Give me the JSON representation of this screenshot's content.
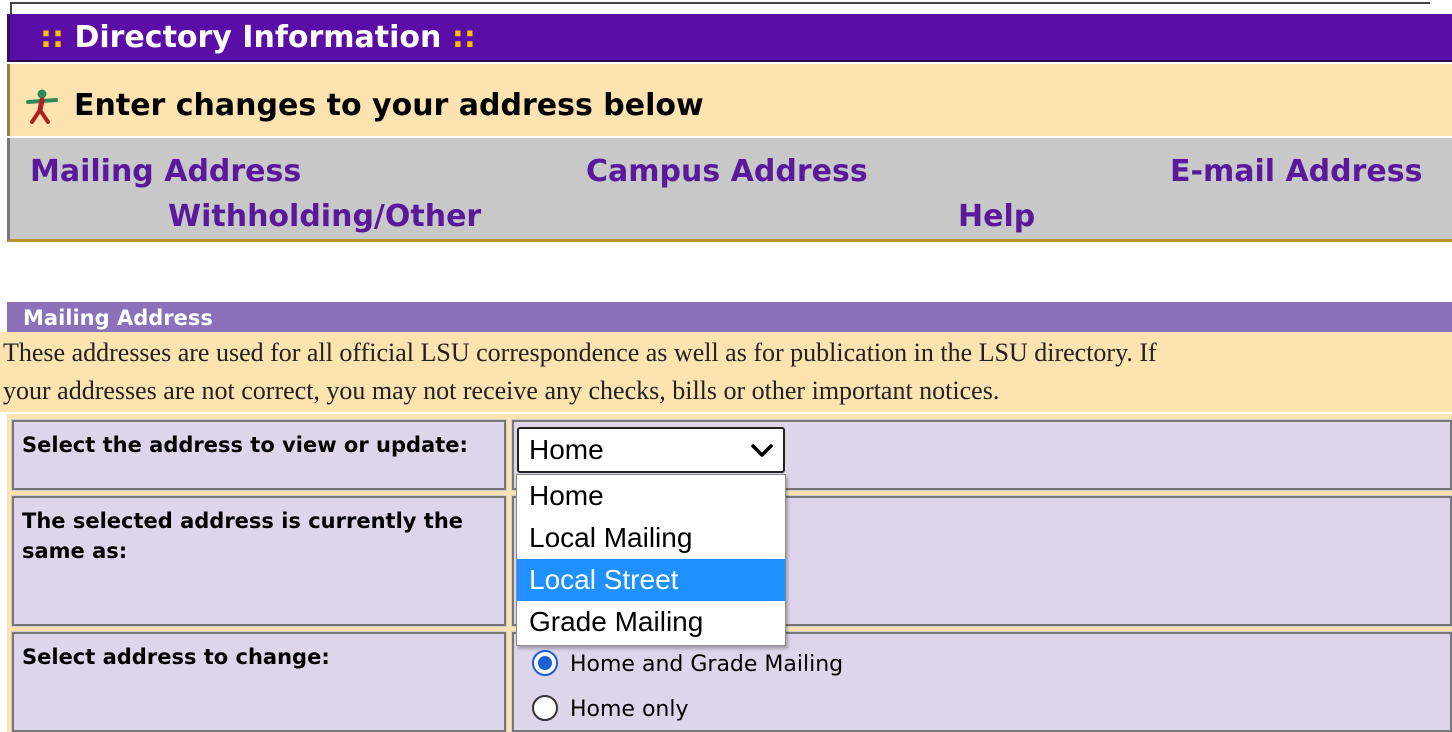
{
  "header": {
    "title_prefix": "::",
    "title": "Directory Information",
    "title_suffix": "::"
  },
  "info_bar": {
    "text": "Enter changes to your address below",
    "icon": "person-walking-icon"
  },
  "nav": {
    "links": [
      "Mailing Address",
      "Campus Address",
      "E-mail Address",
      "Withholding/Other",
      "Help"
    ]
  },
  "section": {
    "title": "Mailing Address",
    "intro_lines": [
      "These addresses are used for all official LSU correspondence as well as for publication in the LSU directory. If",
      "your addresses are not correct, you may not receive any checks, bills or other important notices."
    ]
  },
  "form": {
    "select_label": "Select the address to view or update:",
    "select_value": "Home",
    "options": [
      "Home",
      "Local Mailing",
      "Local Street",
      "Grade Mailing"
    ],
    "highlighted_option": "Local Street",
    "same_as_label": "The selected address is currently the same as:",
    "change_label": "Select address to change:",
    "radios": [
      {
        "label": "Home and Grade Mailing",
        "checked": true
      },
      {
        "label": "Home only",
        "checked": false
      }
    ]
  },
  "colors": {
    "header_purple": "#5b0ea7",
    "accent_gold": "#f5c400",
    "info_bg": "#fde3b0",
    "nav_link": "#5a189a",
    "section_header": "#8a71b9",
    "form_cell": "#ddd5ea",
    "option_highlight": "#1e90ff"
  }
}
